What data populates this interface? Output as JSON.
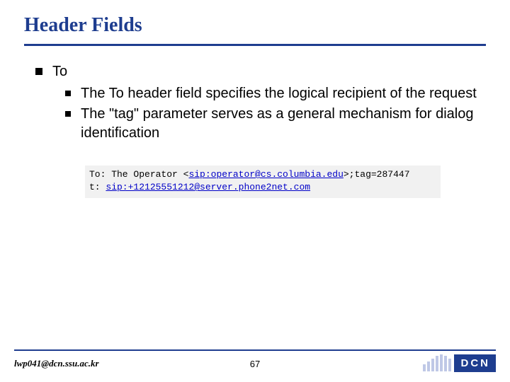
{
  "title": "Header Fields",
  "bullets": {
    "lvl1": "To",
    "lvl2a": "The To header field specifies the logical recipient of the request",
    "lvl2b": "The \"tag\" parameter serves as a general mechanism for dialog identification"
  },
  "example": {
    "line1_prefix": "To: The Operator <",
    "line1_link": "sip:operator@cs.columbia.edu",
    "line1_suffix": ">;tag=287447",
    "line2_prefix": "t: ",
    "line2_link": "sip:+12125551212@server.phone2net.com"
  },
  "footer": {
    "email": "lwp041@dcn.ssu.ac.kr",
    "page": "67",
    "logo": "DCN"
  }
}
